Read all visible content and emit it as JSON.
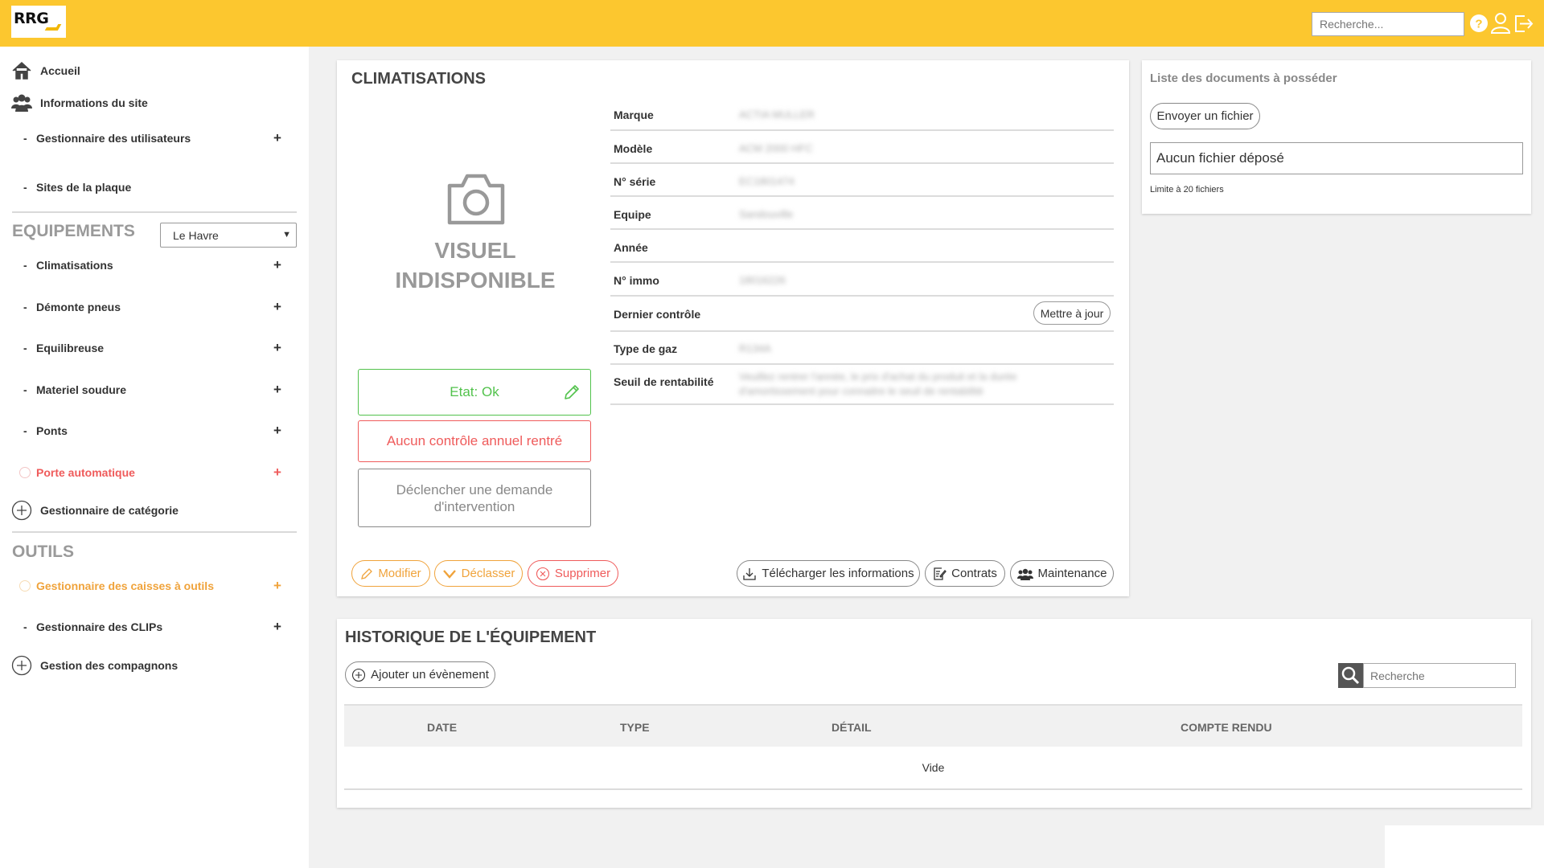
{
  "header": {
    "logo_text": "RRG",
    "search_placeholder": "Recherche...",
    "icons": [
      "help-icon",
      "user-icon",
      "logout-icon"
    ],
    "accent_color": "#fcc72f"
  },
  "sidebar": {
    "home": "Accueil",
    "site_info": "Informations du site",
    "user_manager": "Gestionnaire des utilisateurs",
    "sites_label": "Sites de la plaque",
    "sites_selected": "Le Havre",
    "equipements_title": "EQUIPEMENTS",
    "equipements": [
      {
        "label": "Climatisations",
        "status": "normal"
      },
      {
        "label": "Démonte pneus",
        "status": "normal"
      },
      {
        "label": "Equilibreuse",
        "status": "normal"
      },
      {
        "label": "Materiel soudure",
        "status": "normal"
      },
      {
        "label": "Ponts",
        "status": "normal"
      },
      {
        "label": "Porte automatique",
        "status": "alert"
      }
    ],
    "category_manager": "Gestionnaire de catégorie",
    "outils_title": "OUTILS",
    "outils": [
      {
        "label": "Gestionnaire des caisses à outils",
        "status": "warning"
      },
      {
        "label": "Gestionnaire des CLIPs",
        "status": "normal"
      }
    ],
    "companions": "Gestion des compagnons",
    "plus": "+",
    "dash": "-"
  },
  "equipment": {
    "title": "CLIMATISATIONS",
    "visual_unavailable": "VISUEL INDISPONIBLE",
    "state_ok": "Etat: Ok",
    "no_control": "Aucun contrôle annuel rentré",
    "intervention": "Déclencher une demande d'intervention",
    "fields": [
      {
        "key": "Marque",
        "value": "ACTIA MULLER"
      },
      {
        "key": "Modèle",
        "value": "ACM 2000 HFC"
      },
      {
        "key": "N° série",
        "value": "EC1801474"
      },
      {
        "key": "Equipe",
        "value": "Sandouville"
      },
      {
        "key": "Année",
        "value": ""
      },
      {
        "key": "N° immo",
        "value": "18016226"
      },
      {
        "key": "Dernier contrôle",
        "value": ""
      },
      {
        "key": "Type de gaz",
        "value": "R134A"
      },
      {
        "key": "Seuil de rentabilité",
        "value": "Veuillez rentrer l'année, le prix d'achat du produit et la durée d'amortissement pour connaitre le seuil de rentabilité"
      }
    ],
    "update_button": "Mettre à jour",
    "actions": {
      "modify": "Modifier",
      "downgrade": "Déclasser",
      "delete": "Supprimer",
      "download": "Télécharger les informations",
      "contracts": "Contrats",
      "maintenance": "Maintenance"
    }
  },
  "documents": {
    "title": "Liste des documents à posséder",
    "send_button": "Envoyer un fichier",
    "no_file": "Aucun fichier déposé",
    "limit": "Limite à 20 fichiers"
  },
  "history": {
    "title": "HISTORIQUE DE L'ÉQUIPEMENT",
    "add_event": "Ajouter un évènement",
    "search_placeholder": "Recherche",
    "columns": [
      "DATE",
      "TYPE",
      "DÉTAIL",
      "COMPTE RENDU"
    ],
    "empty": "Vide"
  }
}
